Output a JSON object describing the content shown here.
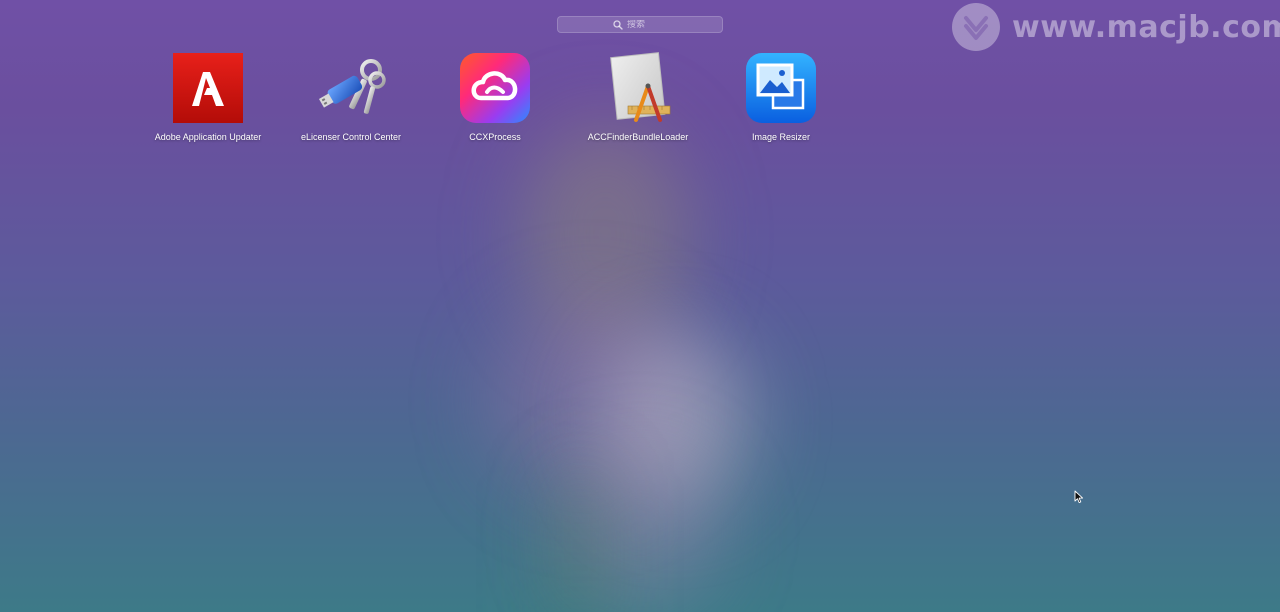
{
  "search": {
    "placeholder": "搜索",
    "icon": "magnifier-icon"
  },
  "watermark": {
    "text": "www.macjb.com"
  },
  "apps": [
    {
      "label": "Adobe Application Updater",
      "icon": "adobe-logo-icon",
      "color": "#d0120e"
    },
    {
      "label": "eLicenser Control Center",
      "icon": "usb-keys-icon",
      "color": "#3a6fd0"
    },
    {
      "label": "CCXProcess",
      "icon": "creative-cloud-icon",
      "color": "#e8306a"
    },
    {
      "label": "ACCFinderBundleLoader",
      "icon": "app-build-icon",
      "color": "#d8d8d8"
    },
    {
      "label": "Image Resizer",
      "icon": "image-resizer-icon",
      "color": "#1e7ff0"
    }
  ]
}
